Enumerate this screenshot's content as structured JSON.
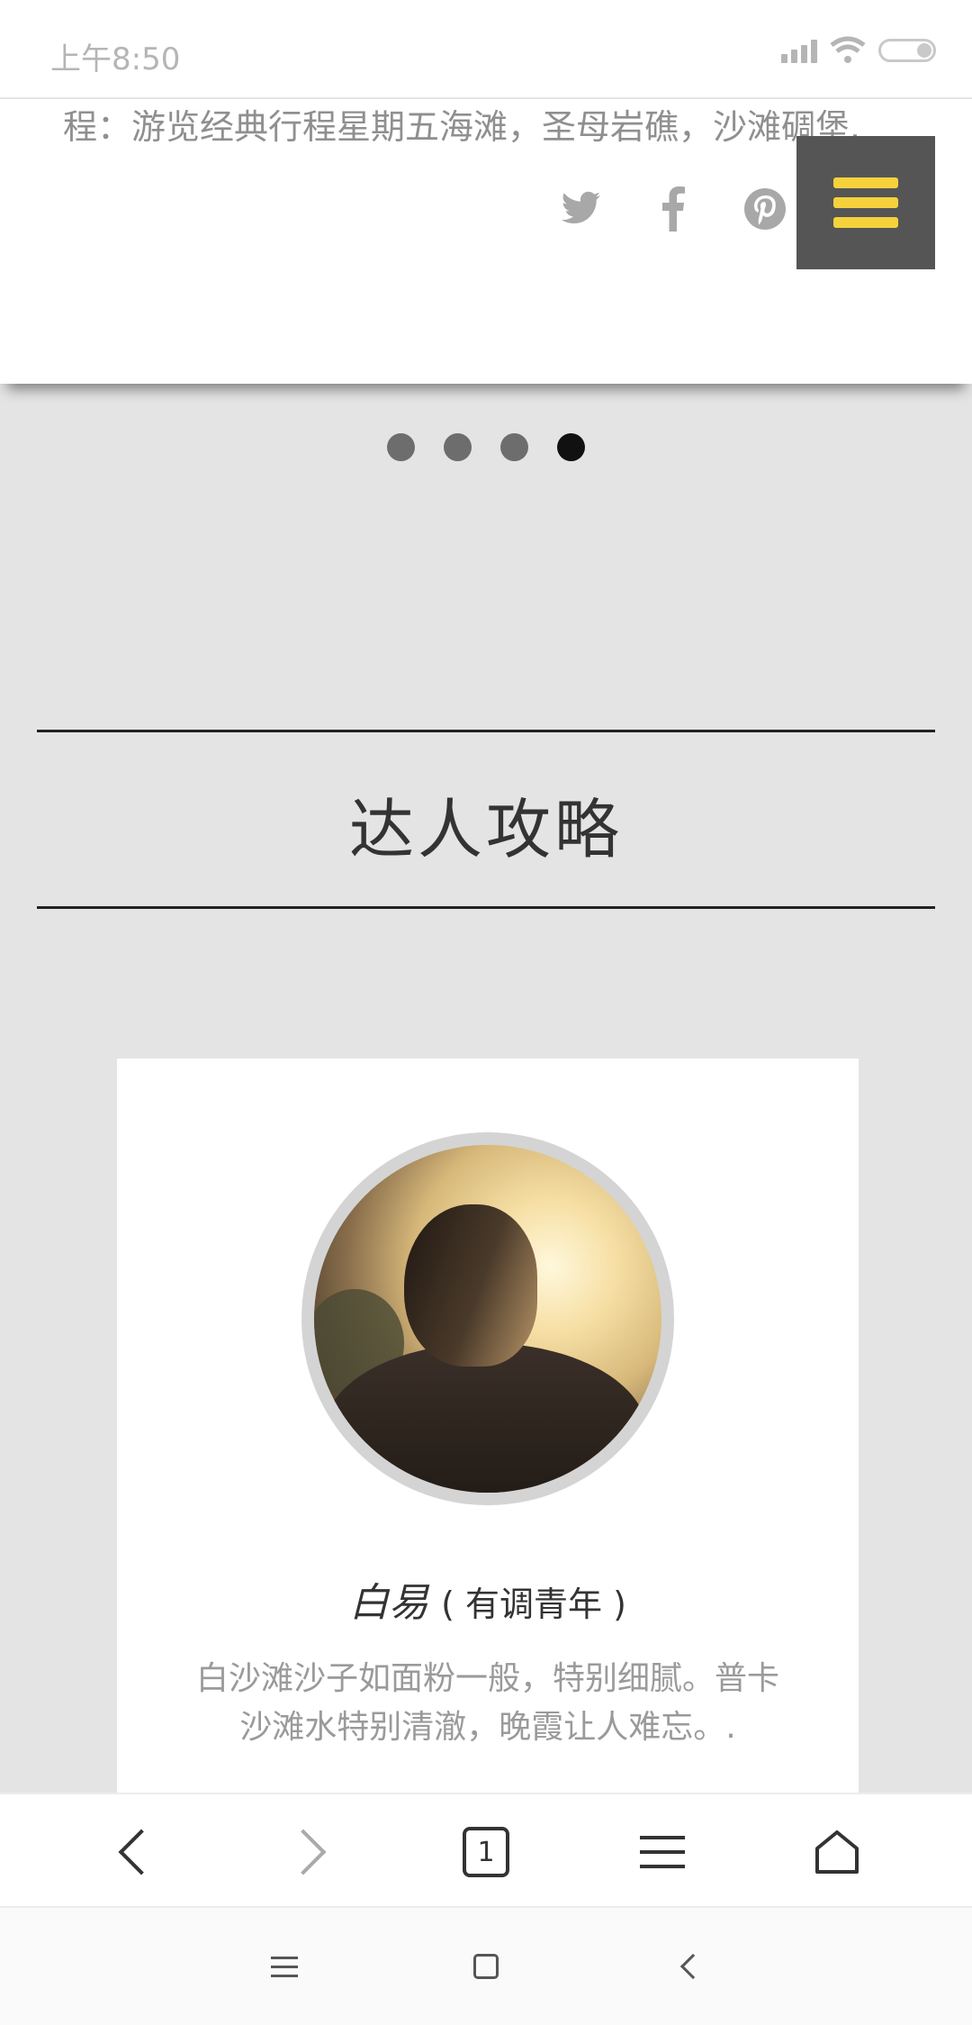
{
  "status_bar": {
    "time": "上午8:50"
  },
  "top_card": {
    "text": "程：游览经典行程星期五海滩，圣母岩礁，沙滩碉堡.",
    "social": {
      "twitter": "twitter-icon",
      "facebook": "facebook-icon",
      "pinterest": "pinterest-icon"
    },
    "menu_button": "menu-icon"
  },
  "slider": {
    "dot_count": 4,
    "active_index": 3
  },
  "section": {
    "title": "达人攻略"
  },
  "author": {
    "name": "白易",
    "title": "( 有调青年 )",
    "description": "白沙滩沙子如面粉一般，特别细腻。普卡沙滩水特别清澈，晚霞让人难忘。."
  },
  "browser_nav": {
    "tab_count": "1"
  },
  "colors": {
    "menu_bg": "#555555",
    "menu_bars": "#f5d23c",
    "page_bg": "#e4e4e4"
  }
}
